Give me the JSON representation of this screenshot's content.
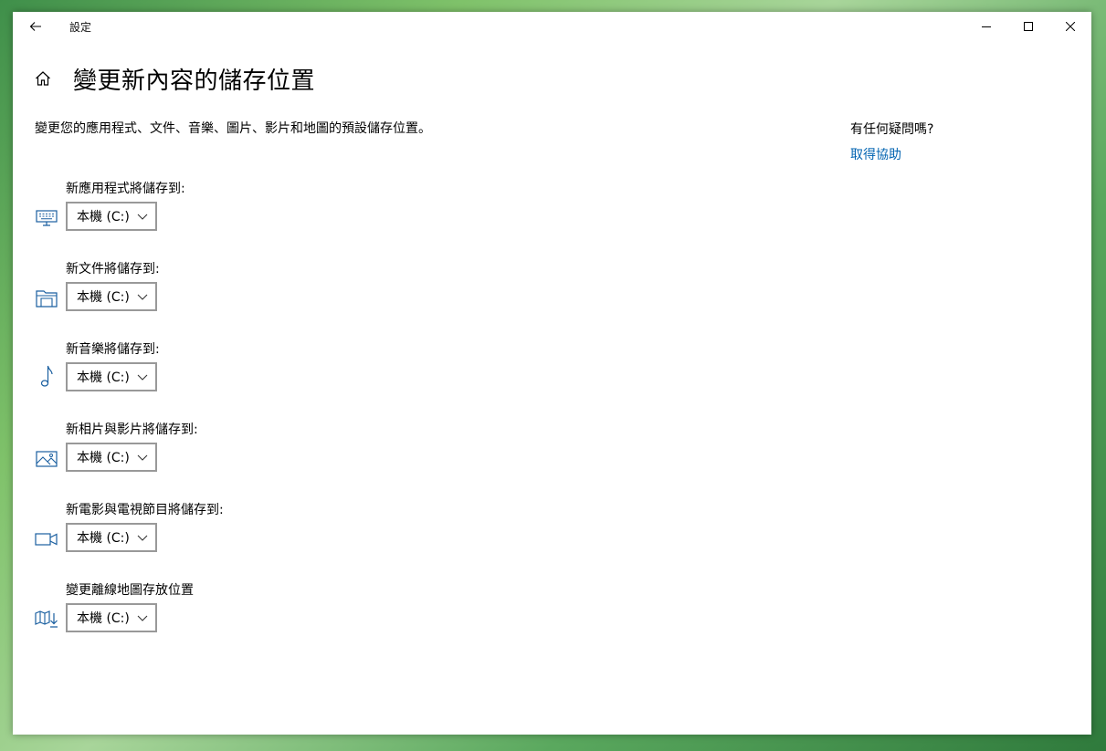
{
  "window": {
    "app_title": "設定"
  },
  "page": {
    "title": "變更新內容的儲存位置",
    "description": "變更您的應用程式、文件、音樂、圖片、影片和地圖的預設儲存位置。"
  },
  "settings": [
    {
      "label": "新應用程式將儲存到:",
      "value": "本機 (C:)",
      "icon": "monitor-icon"
    },
    {
      "label": "新文件將儲存到:",
      "value": "本機 (C:)",
      "icon": "document-folder-icon"
    },
    {
      "label": "新音樂將儲存到:",
      "value": "本機 (C:)",
      "icon": "music-note-icon"
    },
    {
      "label": "新相片與影片將儲存到:",
      "value": "本機 (C:)",
      "icon": "picture-icon"
    },
    {
      "label": "新電影與電視節目將儲存到:",
      "value": "本機 (C:)",
      "icon": "video-camera-icon"
    },
    {
      "label": "變更離線地圖存放位置",
      "value": "本機 (C:)",
      "icon": "map-download-icon"
    }
  ],
  "help": {
    "heading": "有任何疑問嗎?",
    "link": "取得協助"
  },
  "colors": {
    "accent": "#0063b1",
    "icon": "#1a5fa0",
    "dropdown_border": "#999999"
  }
}
